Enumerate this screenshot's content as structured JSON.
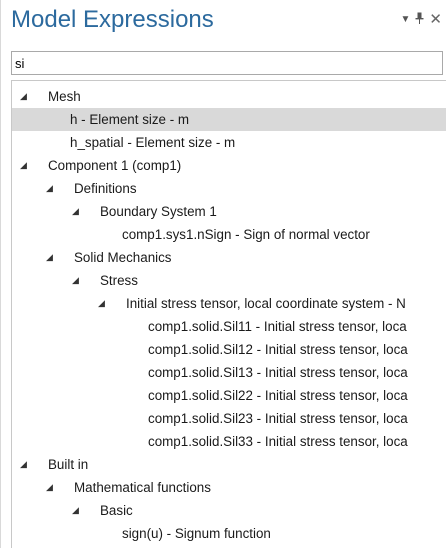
{
  "header": {
    "title": "Model Expressions",
    "controls": {
      "dropdown": "▼",
      "pin": "⊥",
      "close": "✕"
    }
  },
  "search": {
    "value": "si",
    "placeholder": ""
  },
  "tree": [
    {
      "label": "Mesh",
      "expanded": true
    },
    {
      "label": "h - Element size - m",
      "selected": true
    },
    {
      "label": "h_spatial - Element size - m"
    },
    {
      "label": "Component 1 (comp1)",
      "expanded": true
    },
    {
      "label": "Definitions",
      "expanded": true
    },
    {
      "label": "Boundary System 1",
      "expanded": true
    },
    {
      "label": "comp1.sys1.nSign - Sign of normal vector"
    },
    {
      "label": "Solid Mechanics",
      "expanded": true
    },
    {
      "label": "Stress",
      "expanded": true
    },
    {
      "label": "Initial stress tensor, local coordinate system - N",
      "expanded": true
    },
    {
      "label": "comp1.solid.Sil11 - Initial stress tensor, loca"
    },
    {
      "label": "comp1.solid.Sil12 - Initial stress tensor, loca"
    },
    {
      "label": "comp1.solid.Sil13 - Initial stress tensor, loca"
    },
    {
      "label": "comp1.solid.Sil22 - Initial stress tensor, loca"
    },
    {
      "label": "comp1.solid.Sil23 - Initial stress tensor, loca"
    },
    {
      "label": "comp1.solid.Sil33 - Initial stress tensor, loca"
    },
    {
      "label": "Built in",
      "expanded": true
    },
    {
      "label": "Mathematical functions",
      "expanded": true
    },
    {
      "label": "Basic",
      "expanded": true
    },
    {
      "label": "sign(u) - Signum function"
    }
  ],
  "icons": {
    "expanded_toggle": "◢"
  }
}
